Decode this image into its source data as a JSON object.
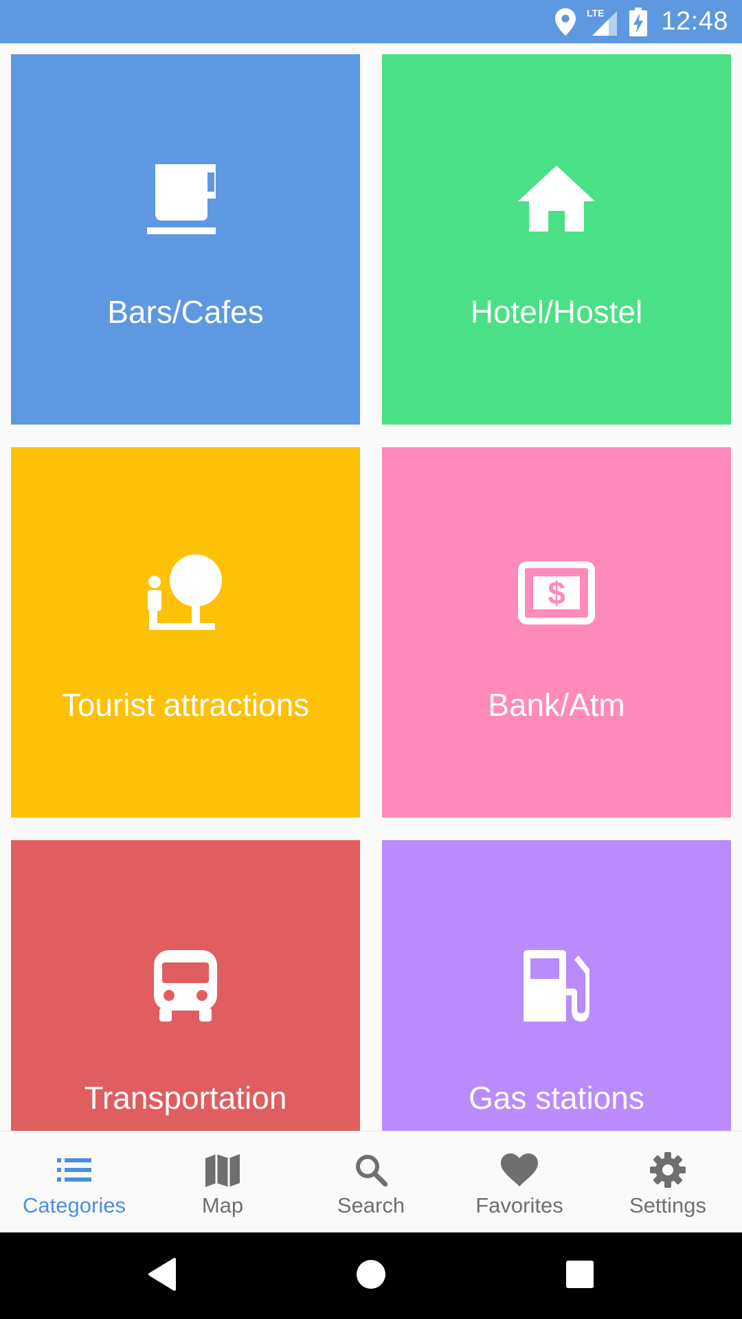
{
  "status_bar": {
    "time": "12:48",
    "network": "LTE",
    "background_color": "#5e98e0",
    "icons": [
      "location-icon",
      "signal-icon",
      "battery-charging-icon"
    ]
  },
  "categories": [
    {
      "label": "Bars/Cafes",
      "icon": "coffee-cup-icon",
      "color": "#5e98e0"
    },
    {
      "label": "Hotel/Hostel",
      "icon": "house-icon",
      "color": "#4ae085"
    },
    {
      "label": "Tourist attractions",
      "icon": "tourist-attraction-icon",
      "color": "#fdc107"
    },
    {
      "label": "Bank/Atm",
      "icon": "atm-money-icon",
      "color": "#ff8abb"
    },
    {
      "label": "Transportation",
      "icon": "bus-icon",
      "color": "#e05e5f"
    },
    {
      "label": "Gas stations",
      "icon": "gas-station-icon",
      "color": "#b98bfd"
    }
  ],
  "bottom_nav": {
    "active_index": 0,
    "active_color": "#4a8fe2",
    "inactive_color": "#6f6f6f",
    "items": [
      {
        "label": "Categories",
        "icon": "list-icon"
      },
      {
        "label": "Map",
        "icon": "map-icon"
      },
      {
        "label": "Search",
        "icon": "search-icon"
      },
      {
        "label": "Favorites",
        "icon": "heart-icon"
      },
      {
        "label": "Settings",
        "icon": "gear-icon"
      }
    ]
  },
  "system_nav": {
    "buttons": [
      "back-icon",
      "home-icon",
      "recents-icon"
    ]
  }
}
